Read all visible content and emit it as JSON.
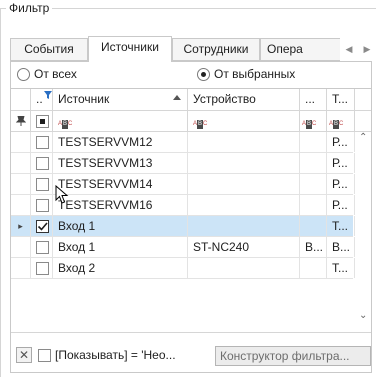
{
  "group": {
    "title": "Фильтр"
  },
  "tabs": [
    {
      "label": "События",
      "active": false
    },
    {
      "label": "Источники",
      "active": true
    },
    {
      "label": "Сотрудники",
      "active": false
    },
    {
      "label": "Опера",
      "active": false
    }
  ],
  "radio": {
    "all_label": "От всех",
    "selected_label": "От выбранных",
    "checked": "selected"
  },
  "grid": {
    "headers": {
      "indicator": "",
      "check": "..",
      "source": "Источник",
      "device": "Устройство",
      "col_x": "...",
      "col_t": "Т..."
    },
    "sort": "source-ascending",
    "filter_row_badge": "ABC",
    "rows": [
      {
        "checked": false,
        "source": "TESTSERVVM12",
        "device": "",
        "x": "",
        "t": "Р...",
        "selected": false
      },
      {
        "checked": false,
        "source": "TESTSERVVM13",
        "device": "",
        "x": "",
        "t": "Р...",
        "selected": false
      },
      {
        "checked": false,
        "source": "TESTSERVVM14",
        "device": "",
        "x": "",
        "t": "Р...",
        "selected": false
      },
      {
        "checked": false,
        "source": "TESTSERVVM16",
        "device": "",
        "x": "",
        "t": "Р...",
        "selected": false
      },
      {
        "checked": true,
        "source": "Вход 1",
        "device": "",
        "x": "",
        "t": "Т...",
        "selected": true,
        "indicator": "▸"
      },
      {
        "checked": false,
        "source": "Вход 1",
        "device": "ST-NC240",
        "x": "В...",
        "t": "В...",
        "selected": false
      },
      {
        "checked": false,
        "source": "Вход 2",
        "device": "",
        "x": "",
        "t": "Т...",
        "selected": false
      }
    ]
  },
  "footer": {
    "filter_text": "[Показывать] = 'Нео...",
    "builder_label": "Конструктор фильтра..."
  },
  "colors": {
    "selected_row": "#cce4f7",
    "border": "#c9c9c9"
  }
}
